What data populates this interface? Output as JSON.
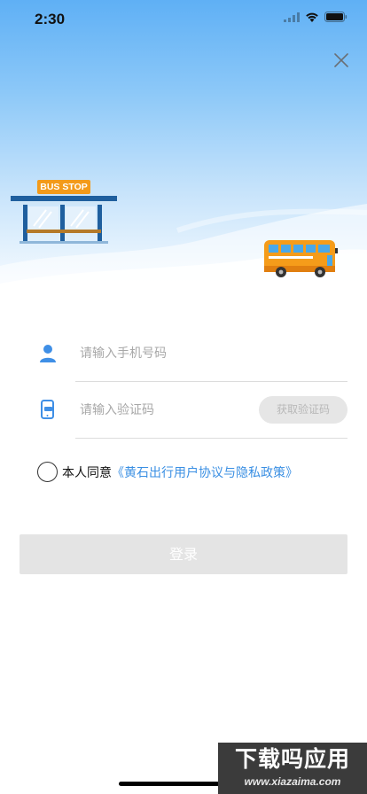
{
  "status_bar": {
    "time": "2:30"
  },
  "header": {
    "bus_stop_sign": "BUS  STOP"
  },
  "form": {
    "phone_placeholder": "请输入手机号码",
    "code_placeholder": "请输入验证码",
    "get_code_label": "获取验证码"
  },
  "agreement": {
    "prefix": "本人同意",
    "link": "《黄石出行用户协议与隐私政策》"
  },
  "login": {
    "label": "登录"
  },
  "watermark": {
    "title": "下载吗应用",
    "url": "www.xiazaima.com"
  },
  "colors": {
    "accent": "#3a8fe3",
    "sign_orange": "#f39a1a",
    "bus_orange": "#f59c1a",
    "button_disabled": "#e4e4e4"
  },
  "icons": {
    "close": "close-icon",
    "phone_field": "user-icon",
    "code_field": "phone-sms-icon"
  }
}
